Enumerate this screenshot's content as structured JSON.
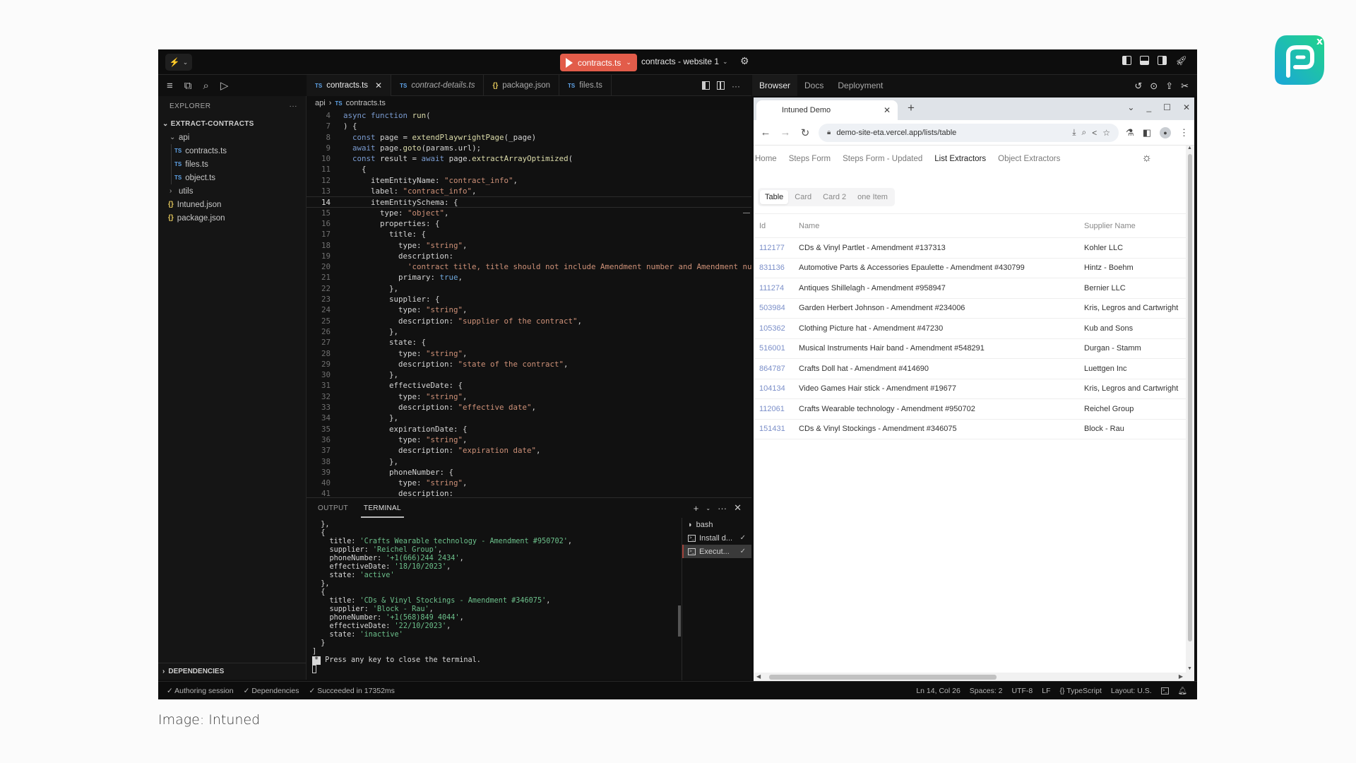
{
  "caption": "Image: Intuned",
  "titlebar": {
    "run_label": "contracts.ts",
    "project_label": "contracts - website 1"
  },
  "sidebar": {
    "header": "EXPLORER",
    "more": "···",
    "root": "EXTRACT-CONTRACTS",
    "folder_api": "api",
    "files_api": [
      {
        "label": "contracts.ts"
      },
      {
        "label": "files.ts"
      },
      {
        "label": "object.ts"
      }
    ],
    "folder_utils": "utils",
    "root_files": [
      {
        "label": "Intuned.json"
      },
      {
        "label": "package.json"
      }
    ],
    "dependencies": "DEPENDENCIES"
  },
  "editor": {
    "tabs": [
      {
        "label": "contracts.ts",
        "type": "TS"
      },
      {
        "label": "contract-details.ts",
        "type": "TS"
      },
      {
        "label": "package.json",
        "type": "{}"
      },
      {
        "label": "files.ts",
        "type": "TS"
      }
    ],
    "breadcrumb": {
      "folder": "api",
      "file": "contracts.ts"
    },
    "lines": [
      {
        "n": "4",
        "t": "async function run("
      },
      {
        "n": "7",
        "t": ") {"
      },
      {
        "n": "8",
        "t": "  const page = extendPlaywrightPage(_page)"
      },
      {
        "n": "9",
        "t": "  await page.goto(params.url);"
      },
      {
        "n": "10",
        "t": "  const result = await page.extractArrayOptimized("
      },
      {
        "n": "11",
        "t": "    {"
      },
      {
        "n": "12",
        "t": "      itemEntityName: \"contract_info\","
      },
      {
        "n": "13",
        "t": "      label: \"contract_info\","
      },
      {
        "n": "14",
        "t": "      itemEntitySchema: {"
      },
      {
        "n": "15",
        "t": "        type: \"object\","
      },
      {
        "n": "16",
        "t": "        properties: {"
      },
      {
        "n": "17",
        "t": "          title: {"
      },
      {
        "n": "18",
        "t": "            type: \"string\","
      },
      {
        "n": "19",
        "t": "            description:"
      },
      {
        "n": "20",
        "t": "              'contract title, title should not include Amendment number and Amendment number"
      },
      {
        "n": "21",
        "t": "            primary: true,"
      },
      {
        "n": "22",
        "t": "          },"
      },
      {
        "n": "23",
        "t": "          supplier: {"
      },
      {
        "n": "24",
        "t": "            type: \"string\","
      },
      {
        "n": "25",
        "t": "            description: \"supplier of the contract\","
      },
      {
        "n": "26",
        "t": "          },"
      },
      {
        "n": "27",
        "t": "          state: {"
      },
      {
        "n": "28",
        "t": "            type: \"string\","
      },
      {
        "n": "29",
        "t": "            description: \"state of the contract\","
      },
      {
        "n": "30",
        "t": "          },"
      },
      {
        "n": "31",
        "t": "          effectiveDate: {"
      },
      {
        "n": "32",
        "t": "            type: \"string\","
      },
      {
        "n": "33",
        "t": "            description: \"effective date\","
      },
      {
        "n": "34",
        "t": "          },"
      },
      {
        "n": "35",
        "t": "          expirationDate: {"
      },
      {
        "n": "36",
        "t": "            type: \"string\","
      },
      {
        "n": "37",
        "t": "            description: \"expiration date\","
      },
      {
        "n": "38",
        "t": "          },"
      },
      {
        "n": "39",
        "t": "          phoneNumber: {"
      },
      {
        "n": "40",
        "t": "            type: \"string\","
      },
      {
        "n": "41",
        "t": "            description:"
      }
    ],
    "current_line": "14"
  },
  "panel": {
    "tabs": [
      "OUTPUT",
      "TERMINAL"
    ],
    "active_tab": "TERMINAL",
    "terminal_lines": [
      "  },",
      "  {",
      "    title: 'Crafts Wearable technology - Amendment #950702',",
      "    supplier: 'Reichel Group',",
      "    phoneNumber: '+1(666)244 2434',",
      "    effectiveDate: '18/10/2023',",
      "    state: 'active'",
      "  },",
      "  {",
      "    title: 'CDs & Vinyl Stockings - Amendment #346075',",
      "    supplier: 'Block - Rau',",
      "    phoneNumber: '+1(568)849 4044',",
      "    effectiveDate: '22/10/2023',",
      "    state: 'inactive'",
      "  }",
      "]"
    ],
    "prompt_symbol": "*",
    "prompt_text": "Press any key to close the terminal.",
    "terminals": [
      {
        "label": "bash",
        "icon": "bash",
        "done": false
      },
      {
        "label": "Install d...",
        "icon": "terminal",
        "done": true
      },
      {
        "label": "Execut...",
        "icon": "terminal",
        "done": true
      }
    ]
  },
  "right_panel": {
    "tabs": [
      "Browser",
      "Docs",
      "Deployment"
    ],
    "active_tab": "Browser"
  },
  "browser": {
    "tab_title": "Intuned Demo",
    "url": "demo-site-eta.vercel.app/lists/table",
    "site_nav": [
      "Home",
      "Steps Form",
      "Steps Form - Updated",
      "List Extractors",
      "Object Extractors"
    ],
    "site_nav_active": "List Extractors",
    "segments": [
      "Table",
      "Card",
      "Card 2",
      "one Item"
    ],
    "segment_active": "Table",
    "table": {
      "columns": [
        "Id",
        "Name",
        "Supplier Name"
      ],
      "rows": [
        {
          "id": "112177",
          "name": "CDs & Vinyl Partlet - Amendment #137313",
          "supplier": "Kohler LLC"
        },
        {
          "id": "831136",
          "name": "Automotive Parts & Accessories Epaulette - Amendment #430799",
          "supplier": "Hintz - Boehm"
        },
        {
          "id": "111274",
          "name": "Antiques Shillelagh - Amendment #958947",
          "supplier": "Bernier LLC"
        },
        {
          "id": "503984",
          "name": "Garden Herbert Johnson - Amendment #234006",
          "supplier": "Kris, Legros and Cartwright"
        },
        {
          "id": "105362",
          "name": "Clothing Picture hat - Amendment #47230",
          "supplier": "Kub and Sons"
        },
        {
          "id": "516001",
          "name": "Musical Instruments Hair band - Amendment #548291",
          "supplier": "Durgan - Stamm"
        },
        {
          "id": "864787",
          "name": "Crafts Doll hat - Amendment #414690",
          "supplier": "Luettgen Inc"
        },
        {
          "id": "104134",
          "name": "Video Games Hair stick - Amendment #19677",
          "supplier": "Kris, Legros and Cartwright"
        },
        {
          "id": "112061",
          "name": "Crafts Wearable technology - Amendment #950702",
          "supplier": "Reichel Group"
        },
        {
          "id": "151431",
          "name": "CDs & Vinyl Stockings - Amendment #346075",
          "supplier": "Block - Rau"
        }
      ]
    }
  },
  "statusbar": {
    "left": [
      "Authoring session",
      "Dependencies",
      "Succeeded in 17352ms"
    ],
    "cursor": "Ln 14, Col 26",
    "spaces": "Spaces: 2",
    "encoding": "UTF-8",
    "eol": "LF",
    "language": "TypeScript",
    "layout": "Layout: U.S."
  },
  "colors": {
    "run_button": "#e25c4a",
    "brand_gradient_start": "#1aa6d9",
    "brand_gradient_end": "#22d48a"
  }
}
